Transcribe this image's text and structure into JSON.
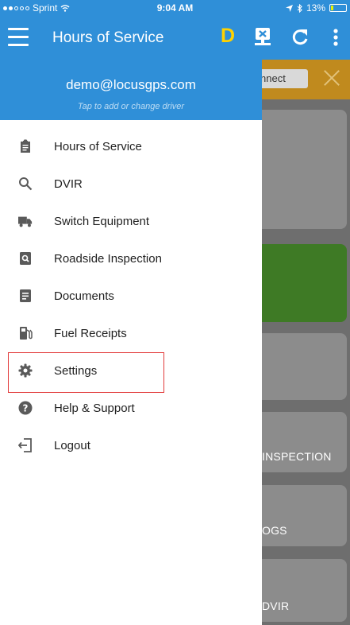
{
  "status_bar": {
    "carrier": "Sprint",
    "time": "9:04 AM",
    "battery_percent": "13%",
    "battery_level": 0.13,
    "icons": [
      "signal-dots-icon",
      "wifi-icon",
      "location-arrow-icon",
      "bluetooth-icon",
      "battery-icon"
    ]
  },
  "app_bar": {
    "title": "Hours of Service",
    "driver_badge": "D",
    "icons": [
      "menu-icon",
      "eld-device-icon",
      "refresh-icon",
      "more-vertical-icon"
    ]
  },
  "drawer": {
    "email": "demo@locusgps.com",
    "hint": "Tap to add or change driver",
    "items": [
      {
        "label": "Hours of Service",
        "icon": "clipboard-icon"
      },
      {
        "label": "DVIR",
        "icon": "search-icon"
      },
      {
        "label": "Switch Equipment",
        "icon": "truck-icon"
      },
      {
        "label": "Roadside Inspection",
        "icon": "inspection-icon"
      },
      {
        "label": "Documents",
        "icon": "document-icon"
      },
      {
        "label": "Fuel Receipts",
        "icon": "fuel-pump-icon"
      },
      {
        "label": "Settings",
        "icon": "gear-icon",
        "highlighted": true
      },
      {
        "label": "Help & Support",
        "icon": "help-circle-icon"
      },
      {
        "label": "Logout",
        "icon": "logout-icon"
      }
    ]
  },
  "background_screen": {
    "connect_button": "nnect",
    "cards": [
      "",
      "",
      "",
      "INSPECTION",
      "OGS",
      "DVIR"
    ]
  },
  "colors": {
    "primary": "#2f8fd8",
    "badge_yellow": "#ffd200",
    "banner_amber": "#c08a1e",
    "highlight_red": "#e23a3a",
    "card_green": "#3e7a25",
    "card_gray": "#8c8c8c"
  }
}
